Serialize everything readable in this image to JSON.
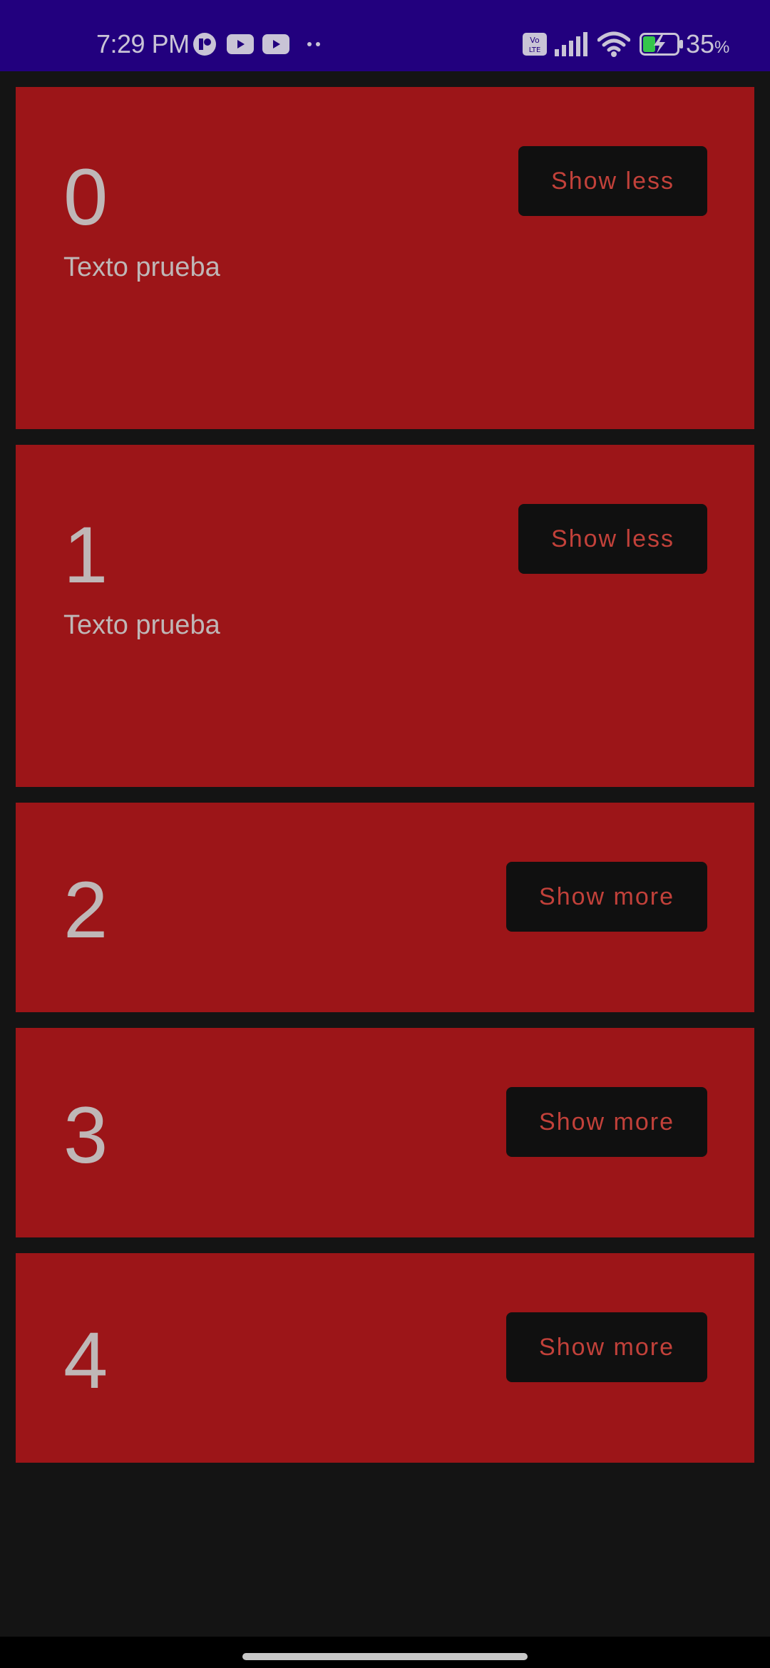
{
  "status_bar": {
    "time": "7:29 PM",
    "battery": "35",
    "battery_unit": "%",
    "volte_top": "Vo",
    "volte_bottom": "LTE",
    "icons": [
      "app-notification-icon",
      "youtube-icon",
      "youtube-icon",
      "more-notifications-icon",
      "volte-icon",
      "signal-icon",
      "wifi-icon",
      "battery-charging-icon"
    ]
  },
  "cards": [
    {
      "number": "0",
      "text": "Texto prueba",
      "button_label": "Show less",
      "expanded": true
    },
    {
      "number": "1",
      "text": "Texto prueba",
      "button_label": "Show less",
      "expanded": true
    },
    {
      "number": "2",
      "button_label": "Show more",
      "expanded": false
    },
    {
      "number": "3",
      "button_label": "Show more",
      "expanded": false
    },
    {
      "number": "4",
      "button_label": "Show more",
      "expanded": false
    }
  ],
  "colors": {
    "status_bar": "#22007e",
    "background": "#141414",
    "card": "#9c1518",
    "button_bg": "#101010",
    "button_text": "#c2413a",
    "card_text": "#bfb7b7"
  }
}
